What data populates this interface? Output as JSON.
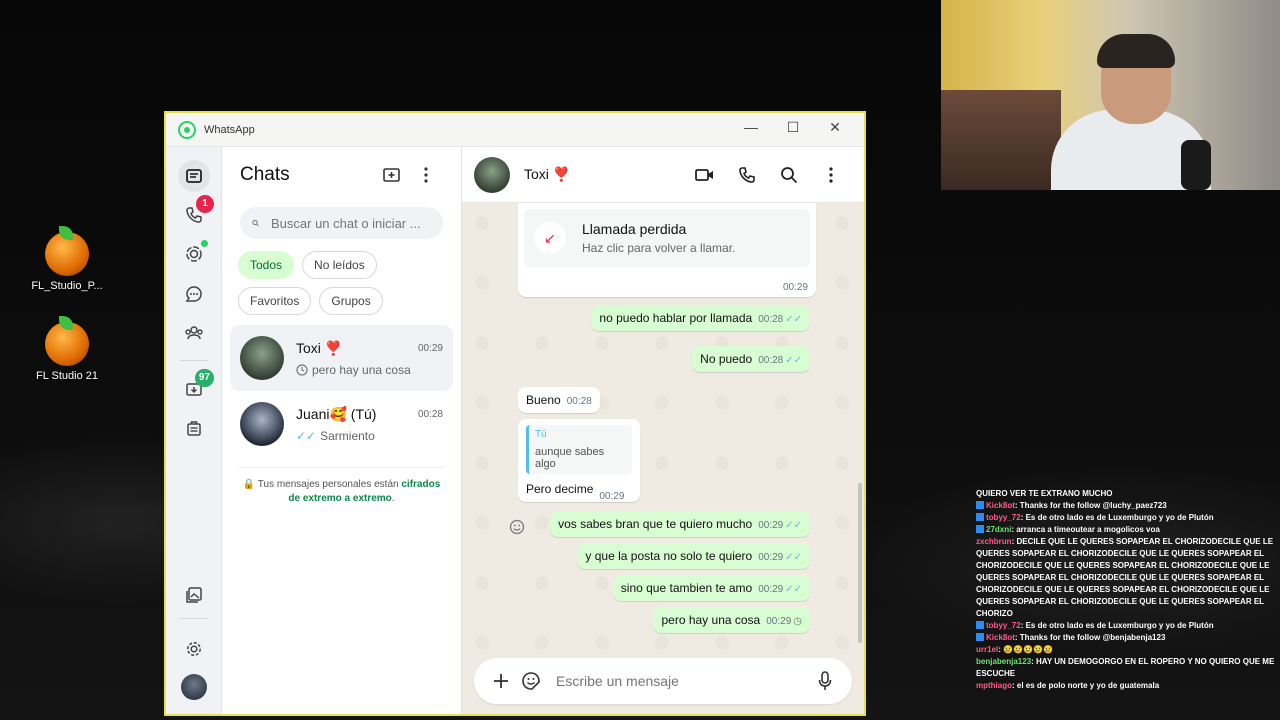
{
  "desktop": {
    "icons": [
      {
        "label": "FL_Studio_P..."
      },
      {
        "label": "FL Studio 21"
      }
    ]
  },
  "window": {
    "title": "WhatsApp",
    "minimize": "—",
    "maximize": "☐",
    "close": "✕"
  },
  "rail": {
    "calls_badge": "1",
    "archive_badge": "97"
  },
  "chatlist": {
    "title": "Chats",
    "search_placeholder": "Buscar un chat o iniciar ...",
    "filters": [
      "Todos",
      "No leídos",
      "Favoritos",
      "Grupos"
    ],
    "chats": [
      {
        "name": "Toxi ❣️",
        "time": "00:29",
        "preview": "pero hay una cosa"
      },
      {
        "name": "Juani🥰 (Tú)",
        "time": "00:28",
        "preview": "Sarmiento"
      }
    ],
    "e2e_text": "Tus mensajes personales están",
    "e2e_link": "cifrados de extremo a extremo",
    "e2e_end": "."
  },
  "conversation": {
    "contact_name": "Toxi ❣️",
    "missed_call": {
      "title": "Llamada perdida",
      "subtitle": "Haz clic para volver a llamar.",
      "time": "00:29"
    },
    "messages": [
      {
        "dir": "out",
        "text": "no puedo hablar por llamada",
        "time": "00:28",
        "status": "read"
      },
      {
        "dir": "out",
        "text": "No puedo",
        "time": "00:28",
        "status": "read"
      },
      {
        "dir": "in",
        "text": "Bueno",
        "time": "00:28"
      },
      {
        "dir": "in",
        "quote_author": "Tú",
        "quote_text": "aunque sabes algo",
        "text": "Pero decime",
        "time": "00:29"
      },
      {
        "dir": "out",
        "text": "vos sabes bran que te quiero mucho",
        "time": "00:29",
        "status": "read"
      },
      {
        "dir": "out",
        "text": "y que la posta no solo te quiero",
        "time": "00:29",
        "status": "read"
      },
      {
        "dir": "out",
        "text": "sino que tambien te amo",
        "time": "00:29",
        "status": "read"
      },
      {
        "dir": "out",
        "text": "pero hay una cosa",
        "time": "00:29",
        "status": "pending"
      }
    ],
    "composer_placeholder": "Escribe un mensaje"
  },
  "stream_chat": [
    {
      "user": "",
      "text": "QUIERO VER TE EXTRANO MUCHO"
    },
    {
      "user": "Kick8ot",
      "text": ": Thanks for the follow @luchy_paez723"
    },
    {
      "user": "tobyy_72",
      "text": ": Es de otro lado es de Luxemburgo y yo de Plutón"
    },
    {
      "user": "27dxni",
      "text": ": arranca a timeoutear a mogolicos voa"
    },
    {
      "user": "zxchbrun",
      "text": ": DECILE QUE LE QUERES SOPAPEAR EL CHORIZODECILE QUE LE QUERES SOPAPEAR EL CHORIZODECILE QUE LE QUERES SOPAPEAR EL CHORIZODECILE QUE LE QUERES SOPAPEAR EL CHORIZODECILE QUE LE QUERES SOPAPEAR EL CHORIZODECILE QUE LE QUERES SOPAPEAR EL CHORIZODECILE QUE LE QUERES SOPAPEAR EL CHORIZODECILE QUE LE QUERES SOPAPEAR EL CHORIZODECILE QUE LE QUERES SOPAPEAR EL CHORIZO"
    },
    {
      "user": "tobyy_72",
      "text": ": Es de otro lado es de Luxemburgo y yo de Plutón"
    },
    {
      "user": "Kick8ot",
      "text": ": Thanks for the follow @benjabenja123"
    },
    {
      "user": "urr1el",
      "text": ": 😢😢😢😢😢"
    },
    {
      "user": "benjabenja123",
      "text": ": HAY UN DEMOGORGO EN EL ROPERO Y NO QUIERO QUE ME ESCUCHE"
    },
    {
      "user": "mpthiago",
      "text": ": el es de polo norte y yo de guatemala"
    }
  ]
}
